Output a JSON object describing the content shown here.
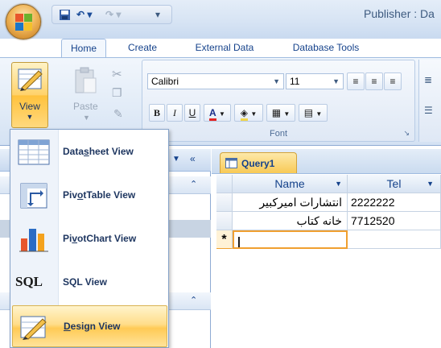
{
  "window": {
    "title": "Publisher : Da",
    "qat": {
      "undo_glyph": "↶ ▾",
      "redo_glyph": "↷ ▾",
      "customize_glyph": "▾"
    }
  },
  "tabs": [
    {
      "label": "Home"
    },
    {
      "label": "Create"
    },
    {
      "label": "External Data"
    },
    {
      "label": "Database Tools"
    }
  ],
  "ribbon": {
    "view_label": "View",
    "paste_label": "Paste",
    "font_name": "Calibri",
    "font_size": "11",
    "font_group_label": "Font",
    "bold_glyph": "B",
    "italic_glyph": "I",
    "underline_glyph": "U",
    "font_color_glyph": "A"
  },
  "document": {
    "tab_label": "Query1",
    "columns": [
      "Name",
      "Tel"
    ],
    "rows": [
      {
        "name": "انتشارات امیرکبیر",
        "tel": "2222222"
      },
      {
        "name": "خانه کتاب",
        "tel": "7712520"
      }
    ],
    "new_row_marker": "*",
    "new_row_cursor": "|"
  },
  "view_menu": {
    "items": [
      {
        "pre": "Data",
        "key": "s",
        "post": "heet View"
      },
      {
        "pre": "Piv",
        "key": "o",
        "post": "tTable View"
      },
      {
        "pre": "Pi",
        "key": "v",
        "post": "otChart View"
      },
      {
        "pre": "",
        "key": "",
        "post": "SQL View",
        "icon_text": "SQL"
      },
      {
        "pre": "",
        "key": "D",
        "post": "esign View"
      }
    ],
    "active_index": 4
  },
  "colors": {
    "accent": "#15428b",
    "highlight": "#ffca55",
    "ribbon": "#dfe8f5",
    "new_row_outline": "#f0a030"
  }
}
